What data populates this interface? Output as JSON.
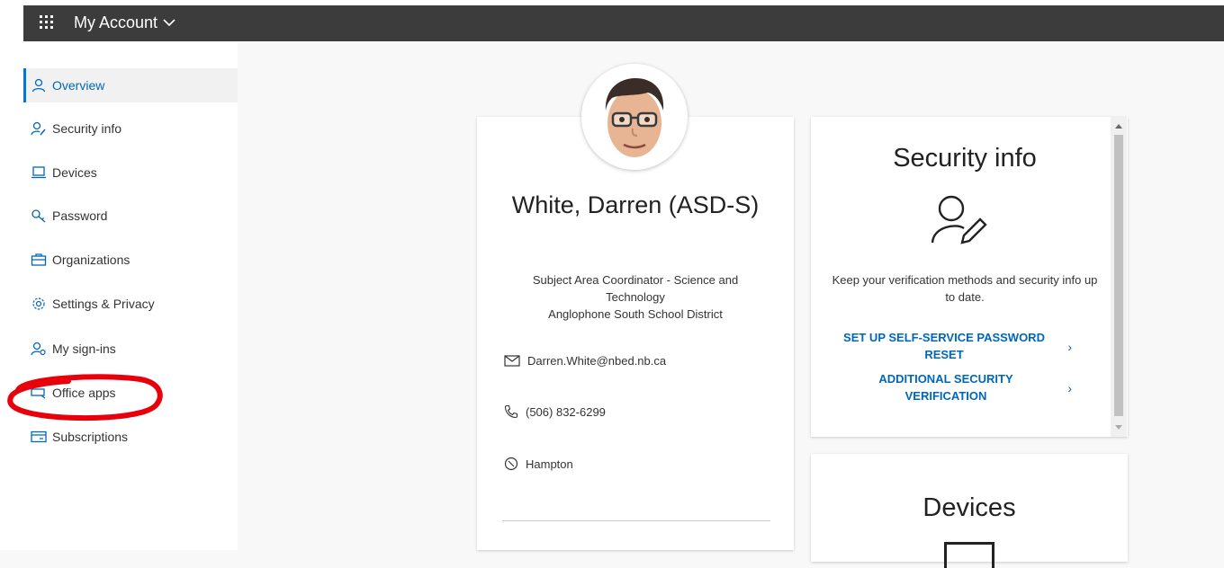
{
  "header": {
    "app_title": "My Account"
  },
  "sidebar": {
    "items": [
      {
        "label": "Overview",
        "icon": "person-icon",
        "active": true
      },
      {
        "label": "Security info",
        "icon": "person-key-icon"
      },
      {
        "label": "Devices",
        "icon": "laptop-icon"
      },
      {
        "label": "Password",
        "icon": "key-icon"
      },
      {
        "label": "Organizations",
        "icon": "briefcase-icon"
      },
      {
        "label": "Settings & Privacy",
        "icon": "gear-icon"
      },
      {
        "label": "My sign-ins",
        "icon": "person-signin-icon"
      },
      {
        "label": "Office apps",
        "icon": "office-apps-icon"
      },
      {
        "label": "Subscriptions",
        "icon": "card-icon"
      }
    ]
  },
  "profile": {
    "name": "White, Darren (ASD-S)",
    "title_line1": "Subject Area Coordinator - Science and Technology",
    "organization": "Anglophone South School District",
    "email": "Darren.White@nbed.nb.ca",
    "phone": "(506) 832-6299",
    "location": "Hampton"
  },
  "security_card": {
    "title": "Security info",
    "description": "Keep your verification methods and security info up to date.",
    "link1": "SET UP SELF-SERVICE PASSWORD RESET",
    "link2": "ADDITIONAL SECURITY VERIFICATION"
  },
  "devices_card": {
    "title": "Devices"
  },
  "colors": {
    "accent": "#0067b8",
    "topbar": "#3c3c3c",
    "annotation": "#e8000b"
  }
}
